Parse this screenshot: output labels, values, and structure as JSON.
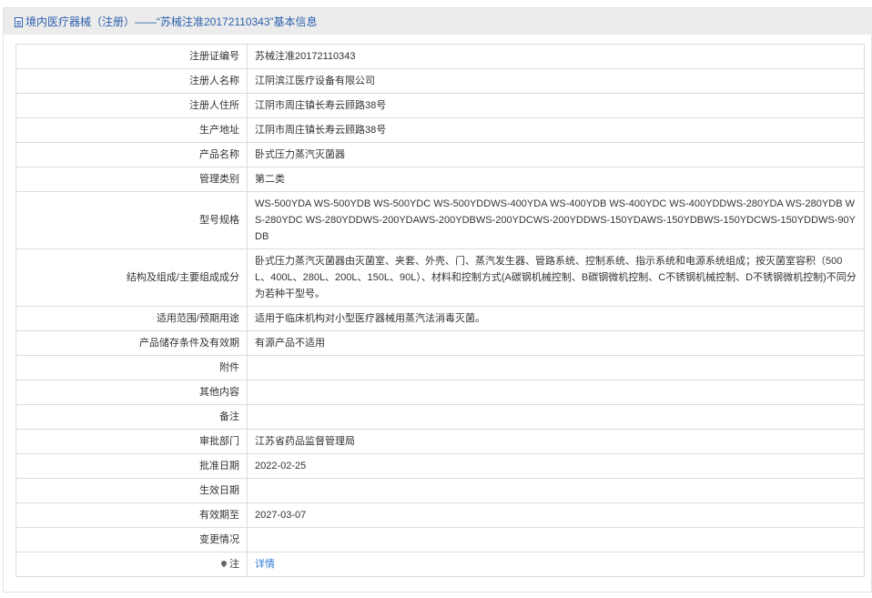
{
  "header": {
    "title": "境内医疗器械（注册）——“苏械注准20172110343”基本信息"
  },
  "rows": [
    {
      "label": "注册证编号",
      "value": "苏械注准20172110343"
    },
    {
      "label": "注册人名称",
      "value": "江阴滨江医疗设备有限公司"
    },
    {
      "label": "注册人住所",
      "value": "江阴市周庄镇长寿云顾路38号"
    },
    {
      "label": "生产地址",
      "value": "江阴市周庄镇长寿云顾路38号"
    },
    {
      "label": "产品名称",
      "value": "卧式压力蒸汽灭菌器"
    },
    {
      "label": "管理类别",
      "value": "第二类"
    },
    {
      "label": "型号规格",
      "value": "WS-500YDA WS-500YDB WS-500YDC WS-500YDDWS-400YDA WS-400YDB WS-400YDC WS-400YDDWS-280YDA WS-280YDB WS-280YDC WS-280YDDWS-200YDAWS-200YDBWS-200YDCWS-200YDDWS-150YDAWS-150YDBWS-150YDCWS-150YDDWS-90YDB"
    },
    {
      "label": "结构及组成/主要组成成分",
      "value": "卧式压力蒸汽灭菌器由灭菌室、夹套、外壳、门、蒸汽发生器、管路系统、控制系统、指示系统和电源系统组成；按灭菌室容积（500L、400L、280L、200L、150L、90L）、材料和控制方式(A碳钢机械控制、B碳钢微机控制、C不锈钢机械控制、D不锈钢微机控制)不同分为若种干型号。"
    },
    {
      "label": "适用范围/预期用途",
      "value": "适用于临床机构对小型医疗器械用蒸汽法消毒灭菌。"
    },
    {
      "label": "产品储存条件及有效期",
      "value": "有源产品不适用"
    },
    {
      "label": "附件",
      "value": ""
    },
    {
      "label": "其他内容",
      "value": ""
    },
    {
      "label": "备注",
      "value": ""
    },
    {
      "label": "审批部门",
      "value": "江苏省药品监督管理局"
    },
    {
      "label": "批准日期",
      "value": "2022-02-25"
    },
    {
      "label": "生效日期",
      "value": ""
    },
    {
      "label": "有效期至",
      "value": "2027-03-07"
    },
    {
      "label": "变更情况",
      "value": ""
    },
    {
      "label": "注",
      "value": "详情"
    }
  ]
}
